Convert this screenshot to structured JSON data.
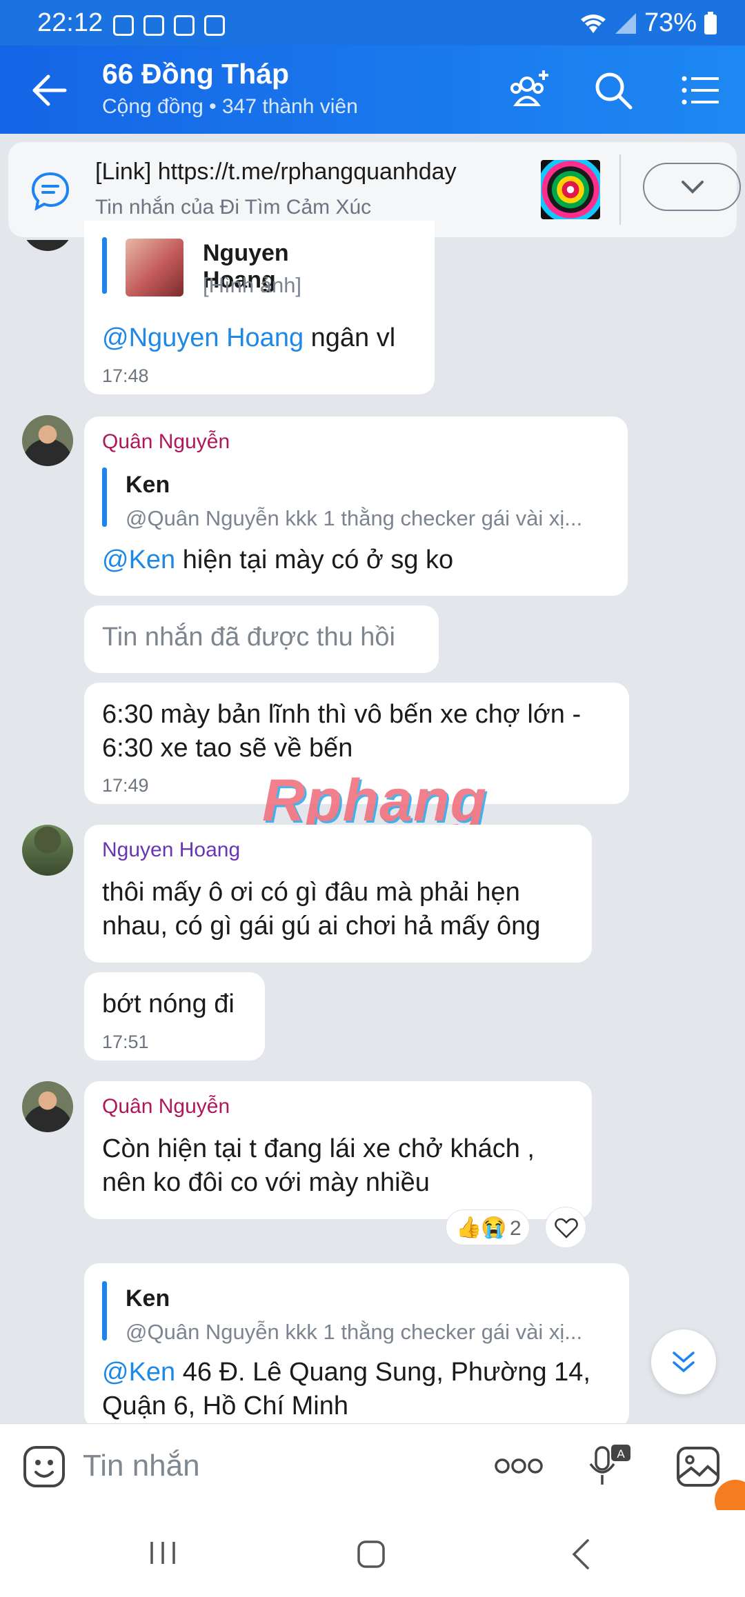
{
  "status_bar": {
    "time": "22:12",
    "battery": "73%"
  },
  "header": {
    "title": "66 Đồng Tháp",
    "subtitle": "Cộng đồng • 347 thành viên"
  },
  "pinned": {
    "text": "[Link] https://t.me/rphangquanhday",
    "subtext": "Tin nhắn của Đi Tìm Cảm Xúc"
  },
  "messages": {
    "m1": {
      "quote_name": "Nguyen Hoang",
      "quote_text": "[Hình ảnh]",
      "mention": "@Nguyen Hoang",
      "text": " ngân vl",
      "time": "17:48"
    },
    "m2": {
      "sender": "Quân Nguyễn",
      "quote_name": "Ken",
      "quote_text": "@Quân Nguyễn kkk 1 thằng checker gái vài xị...",
      "mention": "@Ken",
      "text": " hiện tại mày có ở sg ko"
    },
    "m3": {
      "text": "Tin nhắn đã được thu hồi"
    },
    "m4": {
      "line1": "6:30 mày bản lĩnh thì vô bến xe chợ lớn -",
      "line2": "6:30 xe tao sẽ về bến",
      "time": "17:49"
    },
    "m5": {
      "sender": "Nguyen Hoang",
      "line1": "thôi mấy ô ơi có gì đâu mà phải hẹn",
      "line2": "nhau, có gì gái gú ai chơi hả mấy ông"
    },
    "m6": {
      "text": "bớt nóng đi",
      "time": "17:51"
    },
    "m7": {
      "sender": "Quân Nguyễn",
      "line1": "Còn hiện tại t đang lái xe chở khách ,",
      "line2": "nên ko đôi co với mày nhiều",
      "reaction_count": "2"
    },
    "m8": {
      "quote_name": "Ken",
      "quote_text": "@Quân Nguyễn kkk 1 thằng checker gái vài xị...",
      "mention": "@Ken",
      "line1": " 46 Đ. Lê Quang Sung, Phường 14,",
      "line2": "Quận 6, Hồ Chí Minh"
    }
  },
  "watermark": "Rphang",
  "composer": {
    "placeholder": "Tin nhắn"
  },
  "colors": {
    "header": "#1e88f2",
    "mention": "#1e88e5",
    "sender_red": "#b0175a",
    "sender_purple": "#6a35b5"
  }
}
